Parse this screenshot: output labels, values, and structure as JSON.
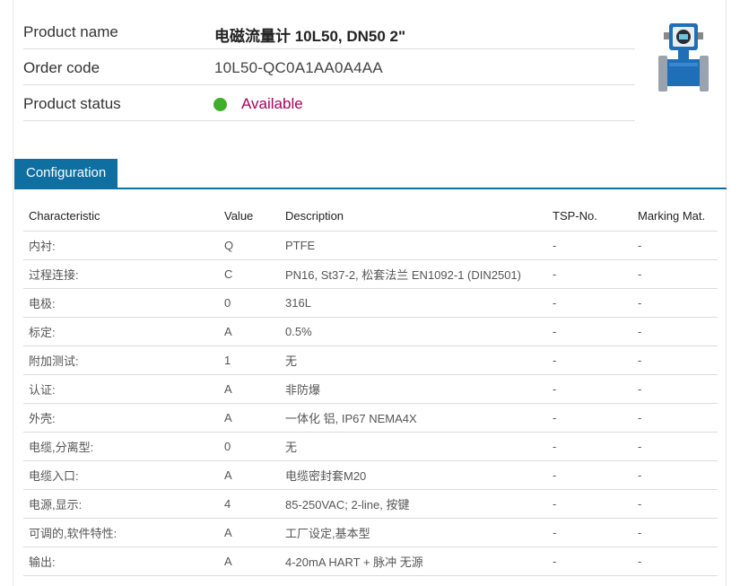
{
  "product": {
    "name_label": "Product name",
    "name_value": "电磁流量计 10L50, DN50 2\"",
    "code_label": "Order code",
    "code_value": "10L50-QC0A1AA0A4AA",
    "status_label": "Product status",
    "status_value": "Available",
    "status_color": "#3fae2a",
    "image_icon": "flowmeter-product-image"
  },
  "tab": {
    "label": "Configuration"
  },
  "table": {
    "headers": [
      "Characteristic",
      "Value",
      "Description",
      "TSP-No.",
      "Marking Mat."
    ],
    "rows": [
      [
        "内衬:",
        "Q",
        "PTFE",
        "-",
        "-"
      ],
      [
        "过程连接:",
        "C",
        "PN16, St37-2, 松套法兰 EN1092-1 (DIN2501)",
        "-",
        "-"
      ],
      [
        "电极:",
        "0",
        "316L",
        "-",
        "-"
      ],
      [
        "标定:",
        "A",
        "0.5%",
        "-",
        "-"
      ],
      [
        "附加测试:",
        "1",
        "无",
        "-",
        "-"
      ],
      [
        "认证:",
        "A",
        "非防爆",
        "-",
        "-"
      ],
      [
        "外壳:",
        "A",
        "一体化 铝, IP67 NEMA4X",
        "-",
        "-"
      ],
      [
        "电缆,分离型:",
        "0",
        "无",
        "-",
        "-"
      ],
      [
        "电缆入口:",
        "A",
        "电缆密封套M20",
        "-",
        "-"
      ],
      [
        "电源,显示:",
        "4",
        "85-250VAC; 2-line, 按键",
        "-",
        "-"
      ],
      [
        "可调的,软件特性:",
        "A",
        "工厂设定,基本型",
        "-",
        "-"
      ],
      [
        "输出:",
        "A",
        "4-20mA HART + 脉冲 无源",
        "-",
        "-"
      ]
    ]
  },
  "colors": {
    "accent": "#0f6fa0",
    "status_text": "#a8005c"
  }
}
